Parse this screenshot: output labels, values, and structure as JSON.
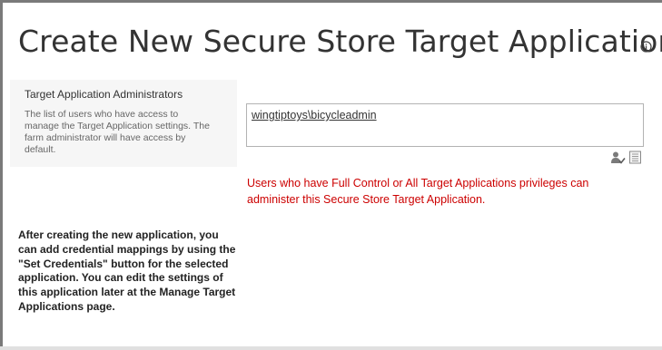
{
  "page": {
    "title": "Create New Secure Store Target Application"
  },
  "administrators_section": {
    "title": "Target Application Administrators",
    "description": "The list of users who have access to manage the Target Application settings. The farm administrator will have access by default.",
    "people_picker": {
      "value": "wingtiptoys\\bicycleadmin"
    },
    "warning": "Users who have Full Control or All Target Applications privileges can administer this Secure Store Target Application."
  },
  "help": {
    "text": "After creating the new application, you can add credential mappings by using the \"Set Credentials\" button for the selected application. You can edit the settings of this application later at the Manage Target Applications page."
  },
  "icons": {
    "info": "info-icon",
    "check_names": "check-names-icon",
    "browse": "address-book-icon"
  },
  "colors": {
    "warning": "#cc0000",
    "title": "#333333",
    "panel_bg": "#f6f6f6"
  }
}
